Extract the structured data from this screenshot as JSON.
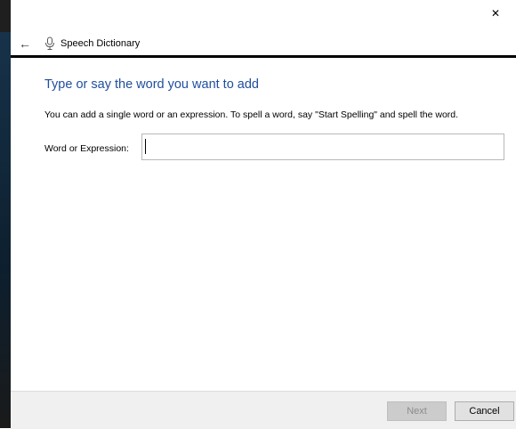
{
  "window": {
    "close_glyph": "✕"
  },
  "nav": {
    "back_glyph": "←",
    "app_icon": "microphone-icon",
    "title": "Speech Dictionary"
  },
  "main": {
    "heading": "Type or say the word you want to add",
    "instructions": "You can add a single word or an expression.  To spell a word, say \"Start Spelling\" and spell the word.",
    "field_label": "Word or Expression:",
    "field_value": "",
    "field_placeholder": ""
  },
  "footer": {
    "next_label": "Next",
    "cancel_label": "Cancel"
  },
  "colors": {
    "heading": "#1f4e9e",
    "nav_border": "#000000",
    "footer_bg": "#f0f0f0"
  }
}
